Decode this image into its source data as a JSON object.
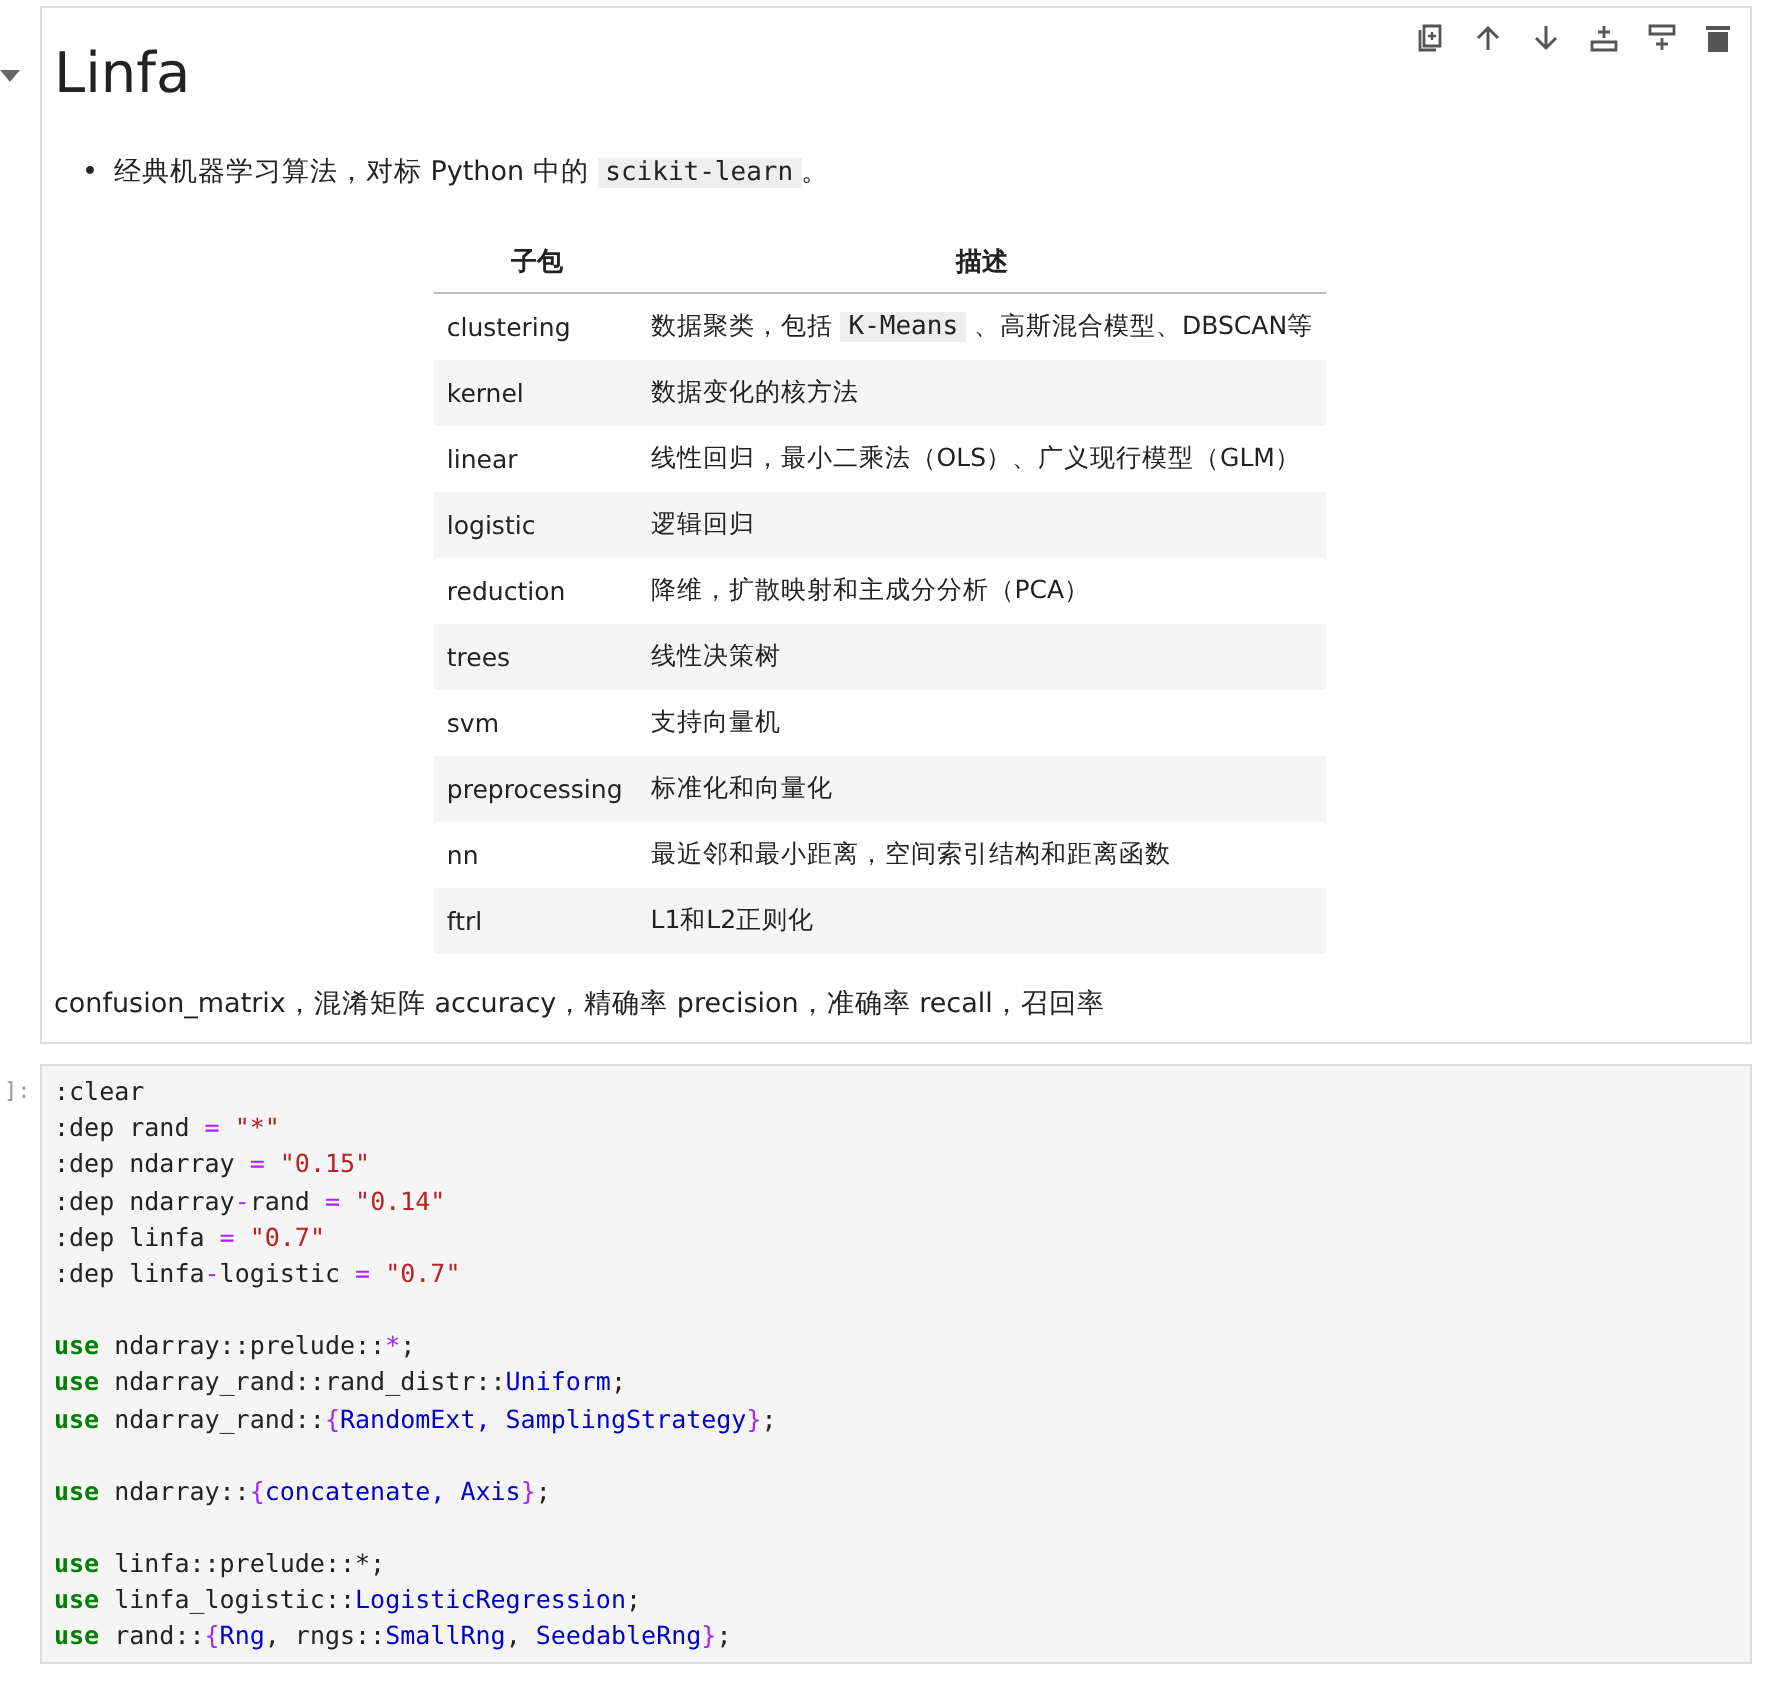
{
  "markdown_cell": {
    "collapsed": false,
    "heading": "Linfa",
    "bullets": [
      {
        "marker": "•",
        "text": "经典机器学习算法，对标 Python 中的 ",
        "code": "scikit-learn",
        "after": "。"
      }
    ],
    "table": {
      "columns": [
        "子包",
        "描述"
      ],
      "rows": [
        {
          "name": "clustering",
          "desc": [
            {
              "t": "数据聚类，包括 ",
              "kind": "text"
            },
            {
              "t": "K-Means",
              "kind": "code"
            },
            {
              "t": " 、高斯混合模型、DBSCAN等",
              "kind": "text"
            }
          ]
        },
        {
          "name": "kernel",
          "desc": [
            {
              "t": "数据变化的核方法",
              "kind": "text"
            }
          ]
        },
        {
          "name": "linear",
          "desc": [
            {
              "t": "线性回归，最小二乘法（OLS）、广义现行模型（GLM）",
              "kind": "text"
            }
          ]
        },
        {
          "name": "logistic",
          "desc": [
            {
              "t": "逻辑回归",
              "kind": "text"
            }
          ]
        },
        {
          "name": "reduction",
          "desc": [
            {
              "t": "降维，扩散映射和主成分分析（PCA）",
              "kind": "text"
            }
          ]
        },
        {
          "name": "trees",
          "desc": [
            {
              "t": "线性决策树",
              "kind": "text"
            }
          ]
        },
        {
          "name": "svm",
          "desc": [
            {
              "t": "支持向量机",
              "kind": "text"
            }
          ]
        },
        {
          "name": "preprocessing",
          "desc": [
            {
              "t": "标准化和向量化",
              "kind": "text"
            }
          ]
        },
        {
          "name": "nn",
          "desc": [
            {
              "t": "最近邻和最小距离，空间索引结构和距离函数",
              "kind": "text"
            }
          ]
        },
        {
          "name": "ftrl",
          "desc": [
            {
              "t": "L1和L2正则化",
              "kind": "text"
            }
          ]
        }
      ]
    },
    "paragraph": "confusion_matrix，混淆矩阵 accuracy，精确率 precision，准确率 recall，召回率"
  },
  "code_cell": {
    "prompt": "]:",
    "blocks": [
      [
        [
          {
            "t": ":clear",
            "kind": "plain"
          }
        ],
        [
          {
            "t": ":dep rand ",
            "kind": "plain"
          },
          {
            "t": "= ",
            "kind": "op"
          },
          {
            "t": "\"*\"",
            "kind": "str"
          }
        ],
        [
          {
            "t": ":dep ndarray ",
            "kind": "plain"
          },
          {
            "t": "= ",
            "kind": "op"
          },
          {
            "t": "\"0.15\"",
            "kind": "str"
          }
        ],
        [
          {
            "t": ":dep ndarray",
            "kind": "plain"
          },
          {
            "t": "-",
            "kind": "op"
          },
          {
            "t": "rand ",
            "kind": "plain"
          },
          {
            "t": "= ",
            "kind": "op"
          },
          {
            "t": "\"0.14\"",
            "kind": "str"
          }
        ],
        [
          {
            "t": ":dep linfa ",
            "kind": "plain"
          },
          {
            "t": "= ",
            "kind": "op"
          },
          {
            "t": "\"0.7\"",
            "kind": "str"
          }
        ],
        [
          {
            "t": ":dep linfa",
            "kind": "plain"
          },
          {
            "t": "-",
            "kind": "op"
          },
          {
            "t": "logistic ",
            "kind": "plain"
          },
          {
            "t": "= ",
            "kind": "op"
          },
          {
            "t": "\"0.7\"",
            "kind": "str"
          }
        ]
      ],
      [
        [
          {
            "t": "use",
            "kind": "kw"
          },
          {
            "t": " ndarray::prelude::",
            "kind": "plain"
          },
          {
            "t": "*",
            "kind": "op"
          },
          {
            "t": ";",
            "kind": "plain"
          }
        ],
        [
          {
            "t": "use",
            "kind": "kw"
          },
          {
            "t": " ndarray_rand::rand_distr::",
            "kind": "plain"
          },
          {
            "t": "Uniform",
            "kind": "type"
          },
          {
            "t": ";",
            "kind": "plain"
          }
        ],
        [
          {
            "t": "use",
            "kind": "kw"
          },
          {
            "t": " ndarray_rand::",
            "kind": "plain"
          },
          {
            "t": "{",
            "kind": "punct"
          },
          {
            "t": "RandomExt, SamplingStrategy",
            "kind": "type"
          },
          {
            "t": "}",
            "kind": "punct"
          },
          {
            "t": ";",
            "kind": "plain"
          }
        ]
      ],
      [
        [
          {
            "t": "use",
            "kind": "kw"
          },
          {
            "t": " ndarray::",
            "kind": "plain"
          },
          {
            "t": "{",
            "kind": "punct"
          },
          {
            "t": "concatenate, Axis",
            "kind": "type"
          },
          {
            "t": "}",
            "kind": "punct"
          },
          {
            "t": ";",
            "kind": "plain"
          }
        ]
      ],
      [
        [
          {
            "t": "use",
            "kind": "kw"
          },
          {
            "t": " linfa::prelude::*;",
            "kind": "plain"
          }
        ],
        [
          {
            "t": "use",
            "kind": "kw"
          },
          {
            "t": " linfa_logistic::",
            "kind": "plain"
          },
          {
            "t": "LogisticRegression",
            "kind": "type"
          },
          {
            "t": ";",
            "kind": "plain"
          }
        ],
        [
          {
            "t": "use",
            "kind": "kw"
          },
          {
            "t": " rand::",
            "kind": "plain"
          },
          {
            "t": "{",
            "kind": "punct"
          },
          {
            "t": "Rng",
            "kind": "type"
          },
          {
            "t": ", rngs::",
            "kind": "plain"
          },
          {
            "t": "SmallRng",
            "kind": "type"
          },
          {
            "t": ", ",
            "kind": "plain"
          },
          {
            "t": "SeedableRng",
            "kind": "type"
          },
          {
            "t": "}",
            "kind": "punct"
          },
          {
            "t": ";",
            "kind": "plain"
          }
        ]
      ]
    ]
  }
}
